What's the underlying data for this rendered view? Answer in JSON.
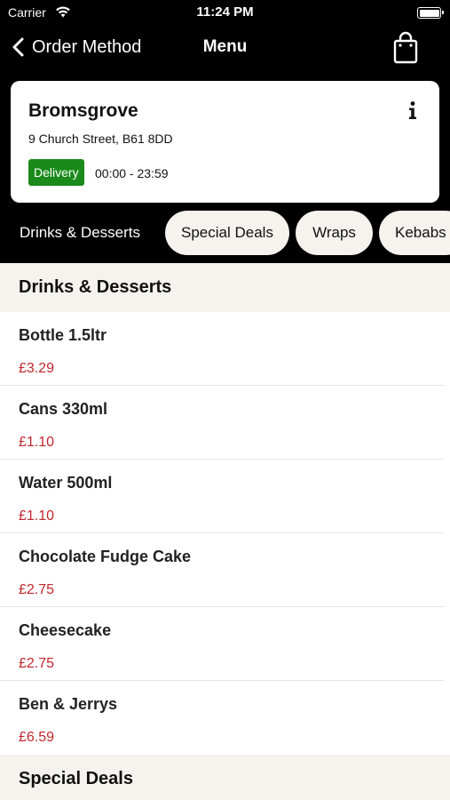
{
  "status_bar": {
    "carrier": "Carrier",
    "time": "11:24 PM"
  },
  "nav": {
    "back_label": "Order Method",
    "title": "Menu"
  },
  "store": {
    "name": "Bromsgrove",
    "address": "9 Church Street, B61 8DD",
    "delivery_badge": "Delivery",
    "hours": "00:00 - 23:59"
  },
  "tabs": [
    {
      "label": "Drinks & Desserts",
      "active": true
    },
    {
      "label": "Special Deals",
      "active": false
    },
    {
      "label": "Wraps",
      "active": false
    },
    {
      "label": "Kebabs",
      "active": false
    }
  ],
  "sections": [
    {
      "title": "Drinks & Desserts",
      "items": [
        {
          "name": "Bottle 1.5ltr",
          "price": "£3.29"
        },
        {
          "name": "Cans 330ml",
          "price": "£1.10"
        },
        {
          "name": "Water 500ml",
          "price": "£1.10"
        },
        {
          "name": "Chocolate Fudge Cake",
          "price": "£2.75"
        },
        {
          "name": "Cheesecake",
          "price": "£2.75"
        },
        {
          "name": "Ben & Jerrys",
          "price": "£6.59"
        }
      ]
    },
    {
      "title": "Special Deals",
      "items": []
    }
  ],
  "colors": {
    "header_bg": "#000000",
    "delivery_green": "#1a8a1a",
    "price_red": "#c1272d",
    "section_bg": "#f6f3ef"
  },
  "icons": {
    "wifi": "wifi-icon",
    "battery": "battery-icon",
    "back": "chevron-left-icon",
    "bag": "shopping-bag-icon",
    "info": "info-icon"
  }
}
